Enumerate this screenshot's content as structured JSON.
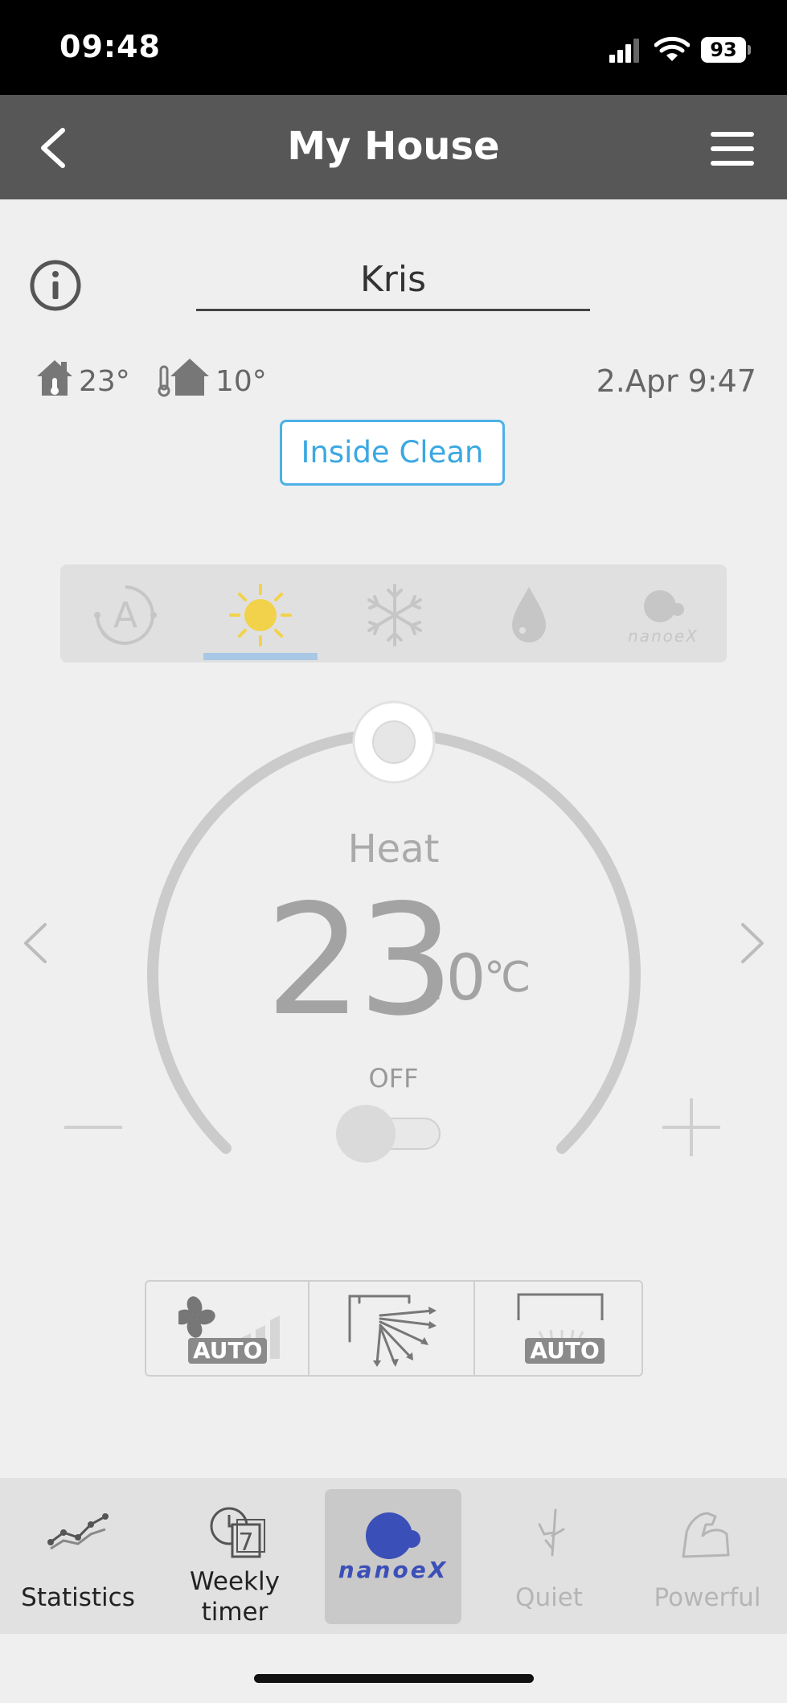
{
  "status_bar": {
    "time": "09:48",
    "battery": "93"
  },
  "header": {
    "title": "My House"
  },
  "device": {
    "name": "Kris"
  },
  "temperatures": {
    "indoor": "23°",
    "outdoor": "10°",
    "timestamp": "2.Apr 9:47"
  },
  "inside_clean": {
    "label": "Inside Clean"
  },
  "modes": {
    "items": [
      "auto",
      "heat",
      "cool",
      "dry",
      "nanoeX"
    ],
    "selected": "heat",
    "nanoe_label": "nanoeX"
  },
  "thermostat": {
    "mode_label": "Heat",
    "temp_whole": "23",
    "temp_decimal": ".0",
    "unit": "℃",
    "power_label": "OFF",
    "power_on": false
  },
  "controls": {
    "fan_badge": "AUTO",
    "vertical_badge": "AUTO"
  },
  "tabs": [
    {
      "label_line1": "Statistics",
      "label_line2": ""
    },
    {
      "label_line1": "Weekly",
      "label_line2": "timer"
    },
    {
      "label_line1": "nanoeX",
      "label_line2": ""
    },
    {
      "label_line1": "Quiet",
      "label_line2": ""
    },
    {
      "label_line1": "Powerful",
      "label_line2": ""
    }
  ],
  "colors": {
    "header_bg": "#575757",
    "accent_blue": "#3aa8e2",
    "heat_sun": "#f2d24a",
    "nanoe_blue": "#3b4fb8",
    "mode_underline": "#a8c8e6"
  }
}
